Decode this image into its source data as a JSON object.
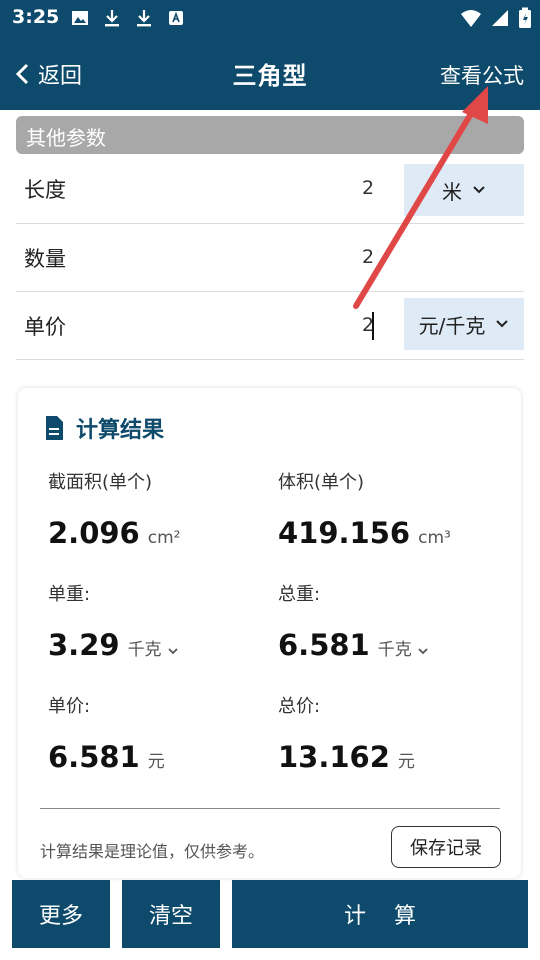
{
  "status": {
    "time": "3:25"
  },
  "header": {
    "back_label": "返回",
    "title": "三角型",
    "formula_label": "查看公式"
  },
  "params": {
    "section_title": "其他参数",
    "rows": [
      {
        "label": "长度",
        "value": "2",
        "unit": "米"
      },
      {
        "label": "数量",
        "value": "2"
      },
      {
        "label": "单价",
        "value": "2",
        "unit": "元/千克"
      }
    ]
  },
  "results": {
    "title": "计算结果",
    "items": [
      {
        "label": "截面积(单个)",
        "value": "2.096",
        "unit": "cm²"
      },
      {
        "label": "体积(单个)",
        "value": "419.156",
        "unit": "cm³"
      },
      {
        "label": "单重:",
        "value": "3.29",
        "unit": "千克"
      },
      {
        "label": "总重:",
        "value": "6.581",
        "unit": "千克"
      },
      {
        "label": "单价:",
        "value": "6.581",
        "unit": "元"
      },
      {
        "label": "总价:",
        "value": "13.162",
        "unit": "元"
      }
    ],
    "note": "计算结果是理论值，仅供参考。",
    "save_label": "保存记录"
  },
  "footer": {
    "more_label": "更多",
    "clear_label": "清空",
    "calc_label": "计    算"
  },
  "colors": {
    "primary": "#0e4a6b",
    "unit_bg": "#deebf7",
    "section_bg": "#a8a8a8",
    "annotation_arrow": "#e04848"
  }
}
